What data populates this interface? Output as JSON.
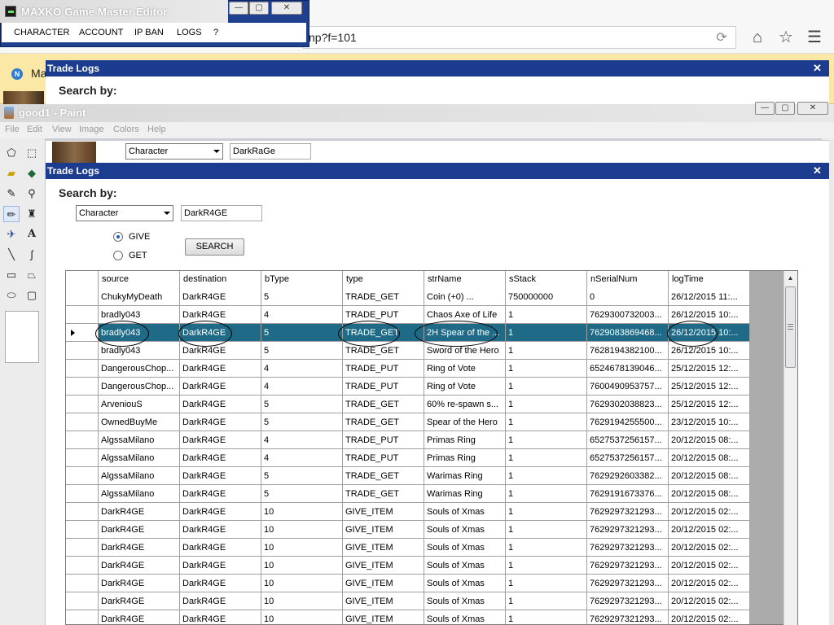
{
  "browser": {
    "url": "np?f=101",
    "reload_icon": "reload-icon",
    "home_icon": "home-icon",
    "star_icon": "star-icon",
    "menu_icon": "hamburger-menu-icon",
    "tab_badge": "N",
    "tab_text": "Ma"
  },
  "gm_editor": {
    "title": "MAXKO Game Master Editor",
    "menu": [
      "CHARACTER",
      "ACCOUNT",
      "IP BAN",
      "LOGS",
      "?"
    ],
    "window_buttons": {
      "minimize": "—",
      "maximize": "▢",
      "close": "✕"
    }
  },
  "trade_log_back": {
    "title": "Trade Logs",
    "close": "✕",
    "search_label": "Search by:",
    "select_value": "Character",
    "input_value": "DarkRaGe"
  },
  "paint": {
    "title": "good1 - Paint",
    "menu": [
      "File",
      "Edit",
      "View",
      "Image",
      "Colors",
      "Help"
    ],
    "window_buttons": {
      "minimize": "—",
      "maximize": "▢",
      "close": "✕"
    }
  },
  "trade_log": {
    "title": "Trade Logs",
    "close": "✕",
    "search_label": "Search by:",
    "select_value": "Character",
    "input_value": "DarkR4GE",
    "radio_give": "GIVE",
    "radio_get": "GET",
    "selected_mode": "GIVE",
    "search_button": "SEARCH",
    "columns": [
      "source",
      "destination",
      "bType",
      "type",
      "strName",
      "sStack",
      "nSerialNum",
      "logTime"
    ],
    "selected_row": 2,
    "rows": [
      [
        "ChukyMyDeath",
        "DarkR4GE",
        "5",
        "TRADE_GET",
        "Coin (+0)          ...",
        "750000000",
        "0",
        "26/12/2015 11:..."
      ],
      [
        "bradly043",
        "DarkR4GE",
        "4",
        "TRADE_PUT",
        "Chaos Axe of Life",
        "1",
        "7629300732003...",
        "26/12/2015 10:..."
      ],
      [
        "bradly043",
        "DarkR4GE",
        "5",
        "TRADE_GET",
        "2H Spear of the ...",
        "1",
        "7629083869468...",
        "26/12/2015 10:..."
      ],
      [
        "bradly043",
        "DarkR4GE",
        "5",
        "TRADE_GET",
        "Sword of the Hero",
        "1",
        "7628194382100...",
        "26/12/2015 10:..."
      ],
      [
        "DangerousChop...",
        "DarkR4GE",
        "4",
        "TRADE_PUT",
        "Ring of Vote",
        "1",
        "6524678139046...",
        "25/12/2015 12:..."
      ],
      [
        "DangerousChop...",
        "DarkR4GE",
        "4",
        "TRADE_PUT",
        "Ring of Vote",
        "1",
        "7600490953757...",
        "25/12/2015 12:..."
      ],
      [
        "ArveniouS",
        "DarkR4GE",
        "5",
        "TRADE_GET",
        "60% re-spawn s...",
        "1",
        "7629302038823...",
        "25/12/2015 12:..."
      ],
      [
        "OwnedBuyMe",
        "DarkR4GE",
        "5",
        "TRADE_GET",
        "Spear of the Hero",
        "1",
        "7629194255500...",
        "23/12/2015 10:..."
      ],
      [
        "AlgssaMilano",
        "DarkR4GE",
        "4",
        "TRADE_PUT",
        "Primas Ring",
        "1",
        "6527537256157...",
        "20/12/2015 08:..."
      ],
      [
        "AlgssaMilano",
        "DarkR4GE",
        "4",
        "TRADE_PUT",
        "Primas Ring",
        "1",
        "6527537256157...",
        "20/12/2015 08:..."
      ],
      [
        "AlgssaMilano",
        "DarkR4GE",
        "5",
        "TRADE_GET",
        "Warimas Ring",
        "1",
        "7629292603382...",
        "20/12/2015 08:..."
      ],
      [
        "AlgssaMilano",
        "DarkR4GE",
        "5",
        "TRADE_GET",
        "Warimas Ring",
        "1",
        "7629191673376...",
        "20/12/2015 08:..."
      ],
      [
        "DarkR4GE",
        "DarkR4GE",
        "10",
        "GIVE_ITEM",
        "Souls of Xmas",
        "1",
        "7629297321293...",
        "20/12/2015 02:..."
      ],
      [
        "DarkR4GE",
        "DarkR4GE",
        "10",
        "GIVE_ITEM",
        "Souls of Xmas",
        "1",
        "7629297321293...",
        "20/12/2015 02:..."
      ],
      [
        "DarkR4GE",
        "DarkR4GE",
        "10",
        "GIVE_ITEM",
        "Souls of Xmas",
        "1",
        "7629297321293...",
        "20/12/2015 02:..."
      ],
      [
        "DarkR4GE",
        "DarkR4GE",
        "10",
        "GIVE_ITEM",
        "Souls of Xmas",
        "1",
        "7629297321293...",
        "20/12/2015 02:..."
      ],
      [
        "DarkR4GE",
        "DarkR4GE",
        "10",
        "GIVE_ITEM",
        "Souls of Xmas",
        "1",
        "7629297321293...",
        "20/12/2015 02:..."
      ],
      [
        "DarkR4GE",
        "DarkR4GE",
        "10",
        "GIVE_ITEM",
        "Souls of Xmas",
        "1",
        "7629297321293...",
        "20/12/2015 02:..."
      ],
      [
        "DarkR4GE",
        "DarkR4GE",
        "10",
        "GIVE_ITEM",
        "Souls of Xmas",
        "1",
        "7629297321293...",
        "20/12/2015 02:..."
      ]
    ]
  },
  "colors": {
    "dialog_titlebar": "#1b3c8f",
    "selected_row": "#1f6b87",
    "bookmark_bar": "#fbe7a6"
  }
}
